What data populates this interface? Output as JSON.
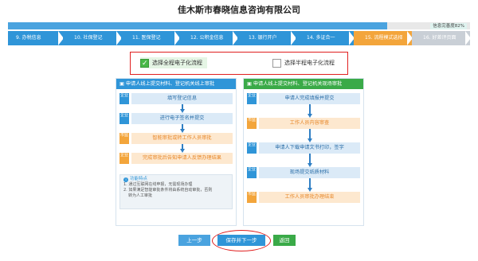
{
  "header": {
    "company": "佳木斯市春晓信息咨询有限公司"
  },
  "progress": {
    "text": "信息完善度82%",
    "value": 0.82
  },
  "steps": [
    {
      "label": "9. 办税信息",
      "state": "done"
    },
    {
      "label": "10. 社保登记",
      "state": "done"
    },
    {
      "label": "11. 医保登记",
      "state": "done"
    },
    {
      "label": "12. 公积金信息",
      "state": "done"
    },
    {
      "label": "13. 银行开户",
      "state": "done"
    },
    {
      "label": "14. 多证合一",
      "state": "done"
    },
    {
      "label": "15. 流程模式选择",
      "state": "active"
    },
    {
      "label": "16. 好差评页面",
      "state": "future"
    }
  ],
  "choices": {
    "full": "选择全程电子化流程",
    "half": "选择半程电子化流程"
  },
  "left_panel": {
    "title": "申请人线上提交材料、登记机关线上审批",
    "rows": [
      {
        "tag": "企业",
        "text": "填写登记信息",
        "color": "blue"
      },
      {
        "tag": "企业",
        "text": "进行电子签名并提交",
        "color": "blue"
      },
      {
        "tag": "市监",
        "text": "智能审批或转工作人员审批",
        "color": "orange"
      },
      {
        "tag": "企业",
        "text": "完成审批后告知申请人反馈办理结果",
        "color": "orange"
      }
    ],
    "features": {
      "title": "功能特点",
      "lines": [
        "1. 通过互联网在线申报，无需现场办理",
        "2. 如果满足智能审批条件将由系统自动审批，否则",
        "   转为人工审批"
      ]
    }
  },
  "right_panel": {
    "title": "申请人线上提交材料、登记机关现场审批",
    "rows": [
      {
        "tag": "企业",
        "text": "申请人完成填报并提交",
        "color": "blue"
      },
      {
        "tag": "市监",
        "text": "工作人员内容审查",
        "color": "orange"
      },
      {
        "tag": "企业",
        "text": "申请人下载申请文书打印，签字",
        "color": "blue"
      },
      {
        "tag": "企业",
        "text": "现场提交纸质材料",
        "color": "blue"
      },
      {
        "tag": "市监",
        "text": "工作人员审批办理结束",
        "color": "orange"
      }
    ]
  },
  "buttons": {
    "prev": "上一步",
    "save": "保存并下一步",
    "back": "返回"
  }
}
